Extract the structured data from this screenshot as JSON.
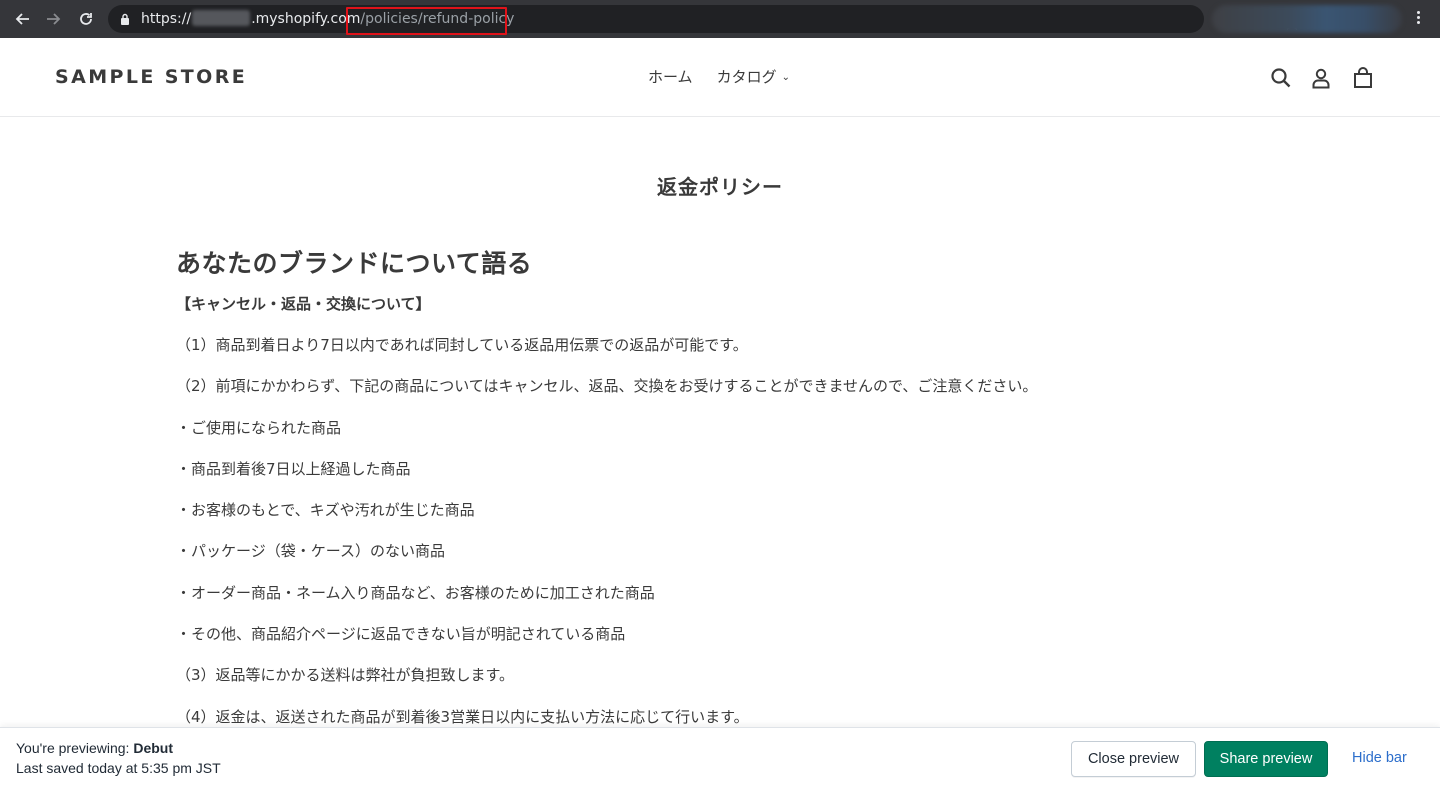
{
  "browser": {
    "url_protocol": "https://",
    "url_host": ".myshopify.com",
    "url_path": "/policies/refund-policy"
  },
  "store": {
    "logo": "SAMPLE STORE",
    "nav": [
      {
        "label": "ホーム"
      },
      {
        "label": "カタログ"
      }
    ]
  },
  "page": {
    "title": "返金ポリシー",
    "heading": "あなたのブランドについて語る",
    "section_label": "【キャンセル・返品・交換について】",
    "paragraphs": [
      "（1）商品到着日より7日以内であれば同封している返品用伝票での返品が可能です。",
      "（2）前項にかかわらず、下記の商品についてはキャンセル、返品、交換をお受けすることができませんので、ご注意ください。",
      "・ご使用になられた商品",
      "・商品到着後7日以上経過した商品",
      "・お客様のもとで、キズや汚れが生じた商品",
      "・パッケージ（袋・ケース）のない商品",
      "・オーダー商品・ネーム入り商品など、お客様のために加工された商品",
      "・その他、商品紹介ページに返品できない旨が明記されている商品",
      "（3）返品等にかかる送料は弊社が負担致します。",
      "（4）返金は、返送された商品が到着後3営業日以内に支払い方法に応じて行います。"
    ]
  },
  "preview_bar": {
    "previewing_prefix": "You're previewing: ",
    "theme_name": "Debut",
    "last_saved": "Last saved today at 5:35 pm JST",
    "close_label": "Close preview",
    "share_label": "Share preview",
    "hide_label": "Hide bar"
  },
  "colors": {
    "share_button": "#008060",
    "hide_link": "#2c6ecb",
    "url_highlight_box": "#e0131a",
    "chrome_bar": "#35363a"
  }
}
